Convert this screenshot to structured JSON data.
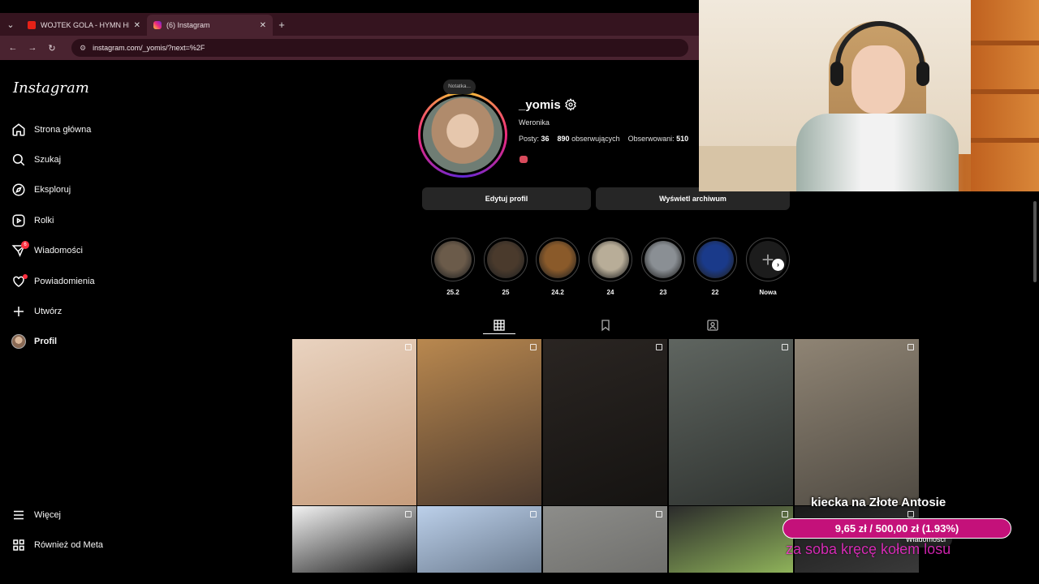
{
  "browser": {
    "tabs": [
      {
        "title": "WOJTEK GOLA - HYMN HETERO",
        "active": false,
        "icon": "youtube-icon"
      },
      {
        "title": "(6) Instagram",
        "active": true,
        "icon": "instagram-icon"
      }
    ],
    "url": "instagram.com/_yomis/?next=%2F"
  },
  "sidebar": {
    "logo": "Instagram",
    "items": [
      {
        "label": "Strona główna",
        "icon": "home-icon"
      },
      {
        "label": "Szukaj",
        "icon": "search-icon"
      },
      {
        "label": "Eksploruj",
        "icon": "compass-icon"
      },
      {
        "label": "Rolki",
        "icon": "reels-icon"
      },
      {
        "label": "Wiadomości",
        "icon": "messenger-icon",
        "badge": "6"
      },
      {
        "label": "Powiadomienia",
        "icon": "heart-icon"
      },
      {
        "label": "Utwórz",
        "icon": "plus-icon"
      },
      {
        "label": "Profil",
        "icon": "avatar"
      }
    ],
    "bottom": [
      {
        "label": "Więcej",
        "icon": "menu-icon"
      },
      {
        "label": "Również od Meta",
        "icon": "meta-icon"
      }
    ]
  },
  "profile": {
    "note": "Notatka...",
    "username": "_yomis",
    "name": "Weronika",
    "posts_label": "Posty:",
    "posts": "36",
    "followers": "890",
    "followers_label": "obserwujących",
    "following_label": "Obserwowani:",
    "following": "510",
    "edit_button": "Edytuj profil",
    "archive_button": "Wyświetl archiwum"
  },
  "highlights": [
    {
      "label": "25.2",
      "color": "#6b5b4a"
    },
    {
      "label": "25",
      "color": "#4a3a2c"
    },
    {
      "label": "24.2",
      "color": "#8a5a2a"
    },
    {
      "label": "24",
      "color": "#b8ad98"
    },
    {
      "label": "23",
      "color": "#8a8f94"
    },
    {
      "label": "22",
      "color": "#1a3a8a"
    },
    {
      "label": "Nowa",
      "color": "#1c1c1c"
    }
  ],
  "posts_grid": [
    {
      "color_a": "#e9d3c0",
      "color_b": "#c79d7c"
    },
    {
      "color_a": "#b9884f",
      "color_b": "#4c3a2e"
    },
    {
      "color_a": "#2a2522",
      "color_b": "#151311"
    },
    {
      "color_a": "#5f6560",
      "color_b": "#2f3330"
    },
    {
      "color_a": "#8f8474",
      "color_b": "#4f4a42"
    },
    {
      "color_a": "#f2f2f2",
      "color_b": "#1c1c1c"
    },
    {
      "color_a": "#bcd0ea",
      "color_b": "#6b7b8f"
    },
    {
      "color_a": "#8d8d8a",
      "color_b": "#6f6f6c"
    },
    {
      "color_a": "#2b2b2b",
      "color_b": "#8fb35a"
    },
    {
      "color_a": "#1a1a1a",
      "color_b": "#3a3a3a"
    }
  ],
  "overlay": {
    "title": "kiecka na Złote Antosie",
    "progress_text": "9,65 zł / 500,00 zł (1.93%)",
    "subtitle": "za soba kręcę kołem losu",
    "messages_pill": "Wiadomości"
  }
}
